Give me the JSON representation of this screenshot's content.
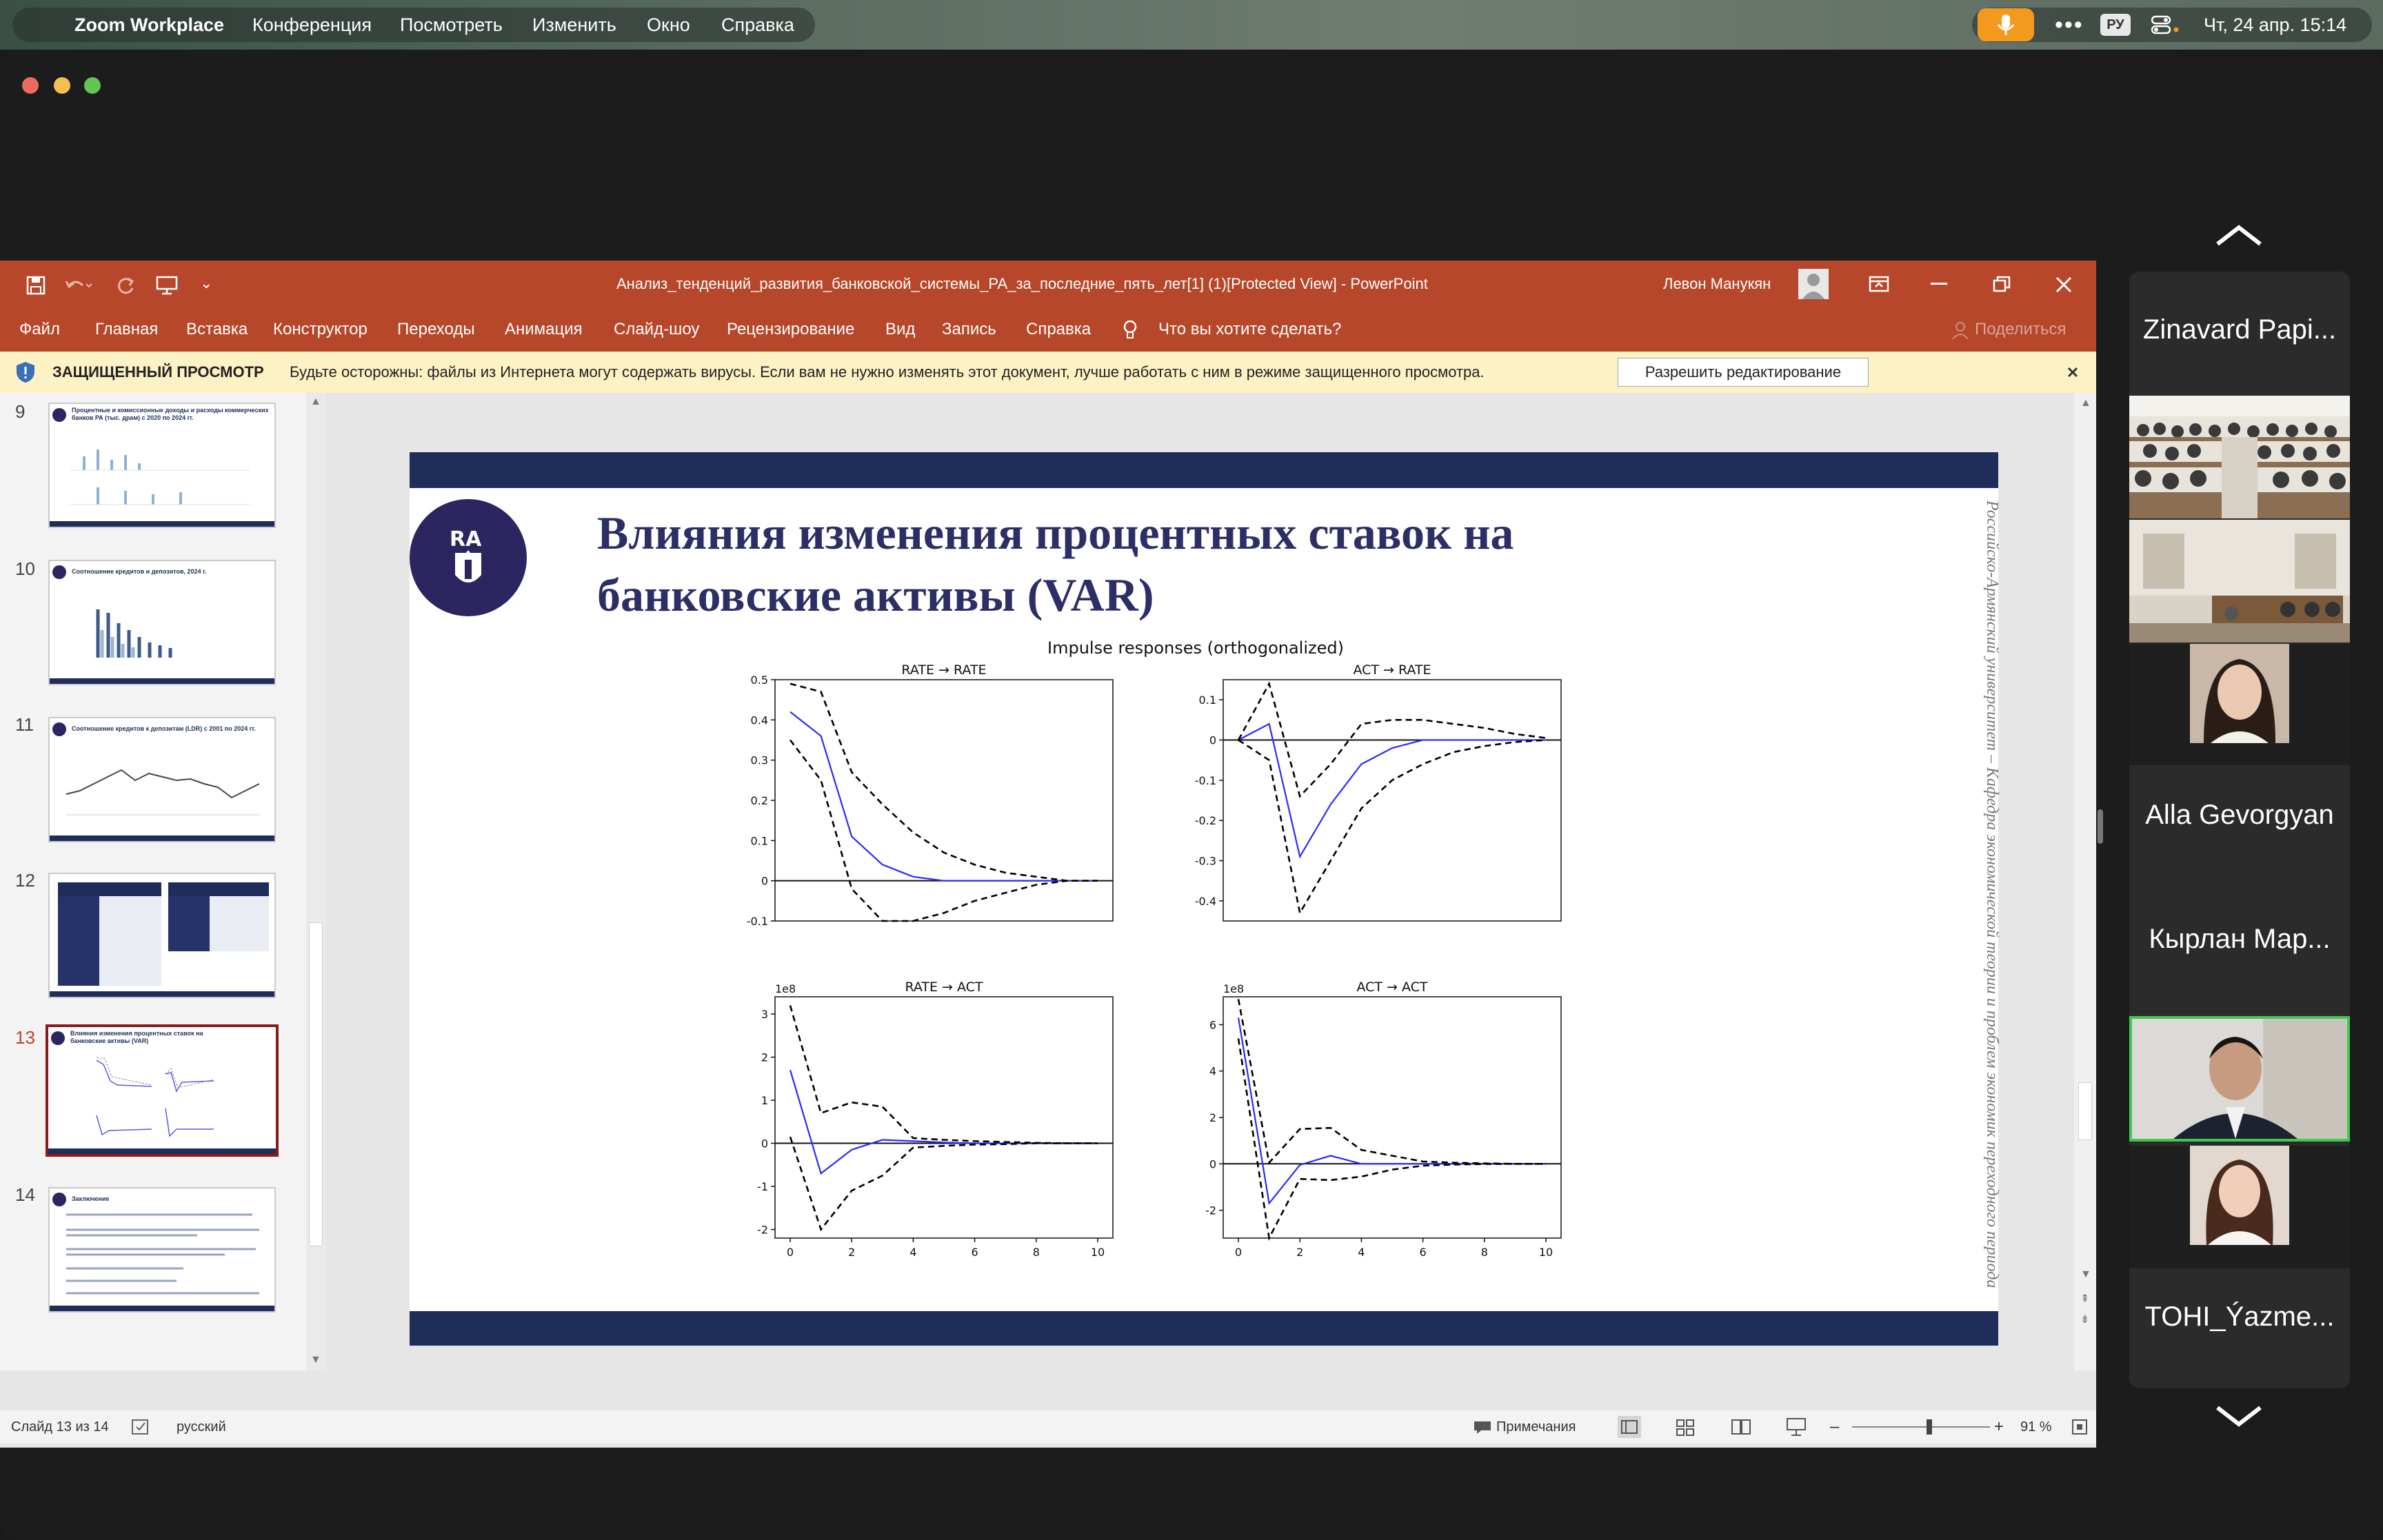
{
  "menubar": {
    "app_name": "Zoom Workplace",
    "items": [
      "Конференция",
      "Посмотреть",
      "Изменить",
      "Окно",
      "Справка"
    ],
    "keyboard_layout": "РУ",
    "clock": "Чт, 24 апр.  15:14"
  },
  "powerpoint": {
    "window_title": "Анализ_тенденций_развития_банковской_системы_РА_за_последние_пять_лет[1] (1)[Protected View]  -  PowerPoint",
    "user_name": "Левон Манукян",
    "tabs": [
      "Файл",
      "Главная",
      "Вставка",
      "Конструктор",
      "Переходы",
      "Анимация",
      "Слайд-шоу",
      "Рецензирование",
      "Вид",
      "Запись",
      "Справка"
    ],
    "tell_me": "Что вы хотите сделать?",
    "share": "Поделиться",
    "protected_title": "ЗАЩИЩЕННЫЙ ПРОСМОТР",
    "protected_message": "Будьте осторожны: файлы из Интернета могут содержать вирусы. Если вам не нужно изменять этот документ, лучше работать с ним в режиме защищенного просмотра.",
    "enable_editing": "Разрешить редактирование",
    "status_slide": "Слайд 13 из 14",
    "status_language": "русский",
    "notes": "Примечания",
    "zoom_level": "91 %",
    "zoom_fraction": 0.56
  },
  "thumbnails": [
    {
      "num": "9",
      "title": "Процентные и комиссионные доходы и расходы коммерческих банков РА (тыс. драм) с 2020 по 2024 гг.",
      "selected": false
    },
    {
      "num": "10",
      "title": "Соотношение кредитов и депозитов, 2024 г.",
      "selected": false
    },
    {
      "num": "11",
      "title": "Соотношение кредитов к депозитам (LDR) с 2001 по 2024 гг.",
      "selected": false
    },
    {
      "num": "12",
      "title": "",
      "selected": false
    },
    {
      "num": "13",
      "title": "Влияния изменения процентных ставок на банковские активы (VAR)",
      "selected": true
    },
    {
      "num": "14",
      "title": "Заключение",
      "selected": false
    }
  ],
  "slide": {
    "logo_text": "RA",
    "title_line1": "Влияния изменения процентных ставок на",
    "title_line2": "банковские активы (VAR)",
    "vertical_text": "Российско-Армянский университет – Кафедра экономической теории и проблем экономик переходного периода"
  },
  "chart_data": [
    {
      "type": "line",
      "suptitle": "Impulse responses (orthogonalized)",
      "title": "RATE → RATE",
      "x": [
        0,
        1,
        2,
        3,
        4,
        5,
        6,
        7,
        8,
        9,
        10
      ],
      "xlim": [
        0,
        10
      ],
      "ylim": [
        -0.1,
        0.5
      ],
      "yticks": [
        -0.1,
        0.0,
        0.1,
        0.2,
        0.3,
        0.4,
        0.5
      ],
      "xticks": [],
      "scale_label": "",
      "series": [
        {
          "values": [
            0.42,
            0.36,
            0.11,
            0.04,
            0.01,
            0.0,
            0.0,
            0.0,
            0.0,
            0.0,
            0.0
          ],
          "color": "#2a2aff",
          "style": "solid"
        },
        {
          "values": [
            0.49,
            0.47,
            0.27,
            0.19,
            0.12,
            0.07,
            0.04,
            0.02,
            0.01,
            0.0,
            0.0
          ],
          "color": "#000000",
          "style": "dashed"
        },
        {
          "values": [
            0.35,
            0.25,
            -0.02,
            -0.1,
            -0.1,
            -0.08,
            -0.05,
            -0.03,
            -0.01,
            0.0,
            0.0
          ],
          "color": "#000000",
          "style": "dashed"
        }
      ]
    },
    {
      "type": "line",
      "title": "ACT → RATE",
      "x": [
        0,
        1,
        2,
        3,
        4,
        5,
        6,
        7,
        8,
        9,
        10
      ],
      "xlim": [
        0,
        10
      ],
      "ylim": [
        -0.45,
        0.15
      ],
      "yticks": [
        -0.4,
        -0.3,
        -0.2,
        -0.1,
        0.0,
        0.1
      ],
      "xticks": [],
      "scale_label": "",
      "series": [
        {
          "values": [
            0.0,
            0.04,
            -0.29,
            -0.16,
            -0.06,
            -0.02,
            0.0,
            0.0,
            0.0,
            0.0,
            0.0
          ],
          "color": "#2a2aff",
          "style": "solid"
        },
        {
          "values": [
            0.0,
            0.14,
            -0.14,
            -0.06,
            0.04,
            0.05,
            0.05,
            0.04,
            0.03,
            0.015,
            0.005
          ],
          "color": "#000000",
          "style": "dashed"
        },
        {
          "values": [
            0.0,
            -0.05,
            -0.43,
            -0.3,
            -0.17,
            -0.1,
            -0.06,
            -0.03,
            -0.015,
            -0.005,
            0.0
          ],
          "color": "#000000",
          "style": "dashed"
        }
      ]
    },
    {
      "type": "line",
      "title": "RATE → ACT",
      "x": [
        0,
        1,
        2,
        3,
        4,
        5,
        6,
        7,
        8,
        9,
        10
      ],
      "xlim": [
        0,
        10
      ],
      "ylim": [
        -2.2,
        3.4
      ],
      "yticks": [
        -2,
        -1,
        0,
        1,
        2,
        3
      ],
      "xticks": [
        0,
        2,
        4,
        6,
        8,
        10
      ],
      "scale_label": "1e8",
      "series": [
        {
          "values": [
            1.7,
            -0.7,
            -0.15,
            0.08,
            0.05,
            0.02,
            0.0,
            0.0,
            0.0,
            0.0,
            0.0
          ],
          "color": "#2a2aff",
          "style": "solid"
        },
        {
          "values": [
            3.2,
            0.7,
            0.95,
            0.85,
            0.12,
            0.08,
            0.05,
            0.03,
            0.01,
            0.0,
            0.0
          ],
          "color": "#000000",
          "style": "dashed"
        },
        {
          "values": [
            0.15,
            -2.0,
            -1.1,
            -0.75,
            -0.1,
            -0.06,
            -0.03,
            -0.02,
            0.0,
            0.0,
            0.0
          ],
          "color": "#000000",
          "style": "dashed"
        }
      ]
    },
    {
      "type": "line",
      "title": "ACT → ACT",
      "x": [
        0,
        1,
        2,
        3,
        4,
        5,
        6,
        7,
        8,
        9,
        10
      ],
      "xlim": [
        0,
        10
      ],
      "ylim": [
        -3.2,
        7.2
      ],
      "yticks": [
        -2,
        0,
        2,
        4,
        6
      ],
      "xticks": [
        0,
        2,
        4,
        6,
        8,
        10
      ],
      "scale_label": "1e8",
      "series": [
        {
          "values": [
            6.3,
            -1.7,
            -0.05,
            0.35,
            0.0,
            0.0,
            0.0,
            0.0,
            0.0,
            0.0,
            0.0
          ],
          "color": "#2a2aff",
          "style": "solid"
        },
        {
          "values": [
            7.1,
            0.05,
            1.5,
            1.55,
            0.6,
            0.35,
            0.1,
            0.05,
            0.02,
            0.0,
            0.0
          ],
          "color": "#000000",
          "style": "dashed"
        },
        {
          "values": [
            5.4,
            -3.2,
            -0.65,
            -0.7,
            -0.55,
            -0.25,
            -0.08,
            -0.03,
            -0.01,
            0.0,
            0.0
          ],
          "color": "#000000",
          "style": "dashed"
        }
      ]
    }
  ],
  "gallery": {
    "participants": [
      {
        "name": "Zinavard Papi..."
      },
      {
        "name": "Alla Gevorgyan"
      },
      {
        "name": "Кырлан Мар..."
      },
      {
        "name": "TOHI_Ýazme..."
      }
    ]
  },
  "colors": {
    "powerpoint_accent": "#b7472a",
    "slide_navy": "#1f2d5a",
    "protected_bar": "#fdf2c4",
    "active_speaker": "#3fcb4f",
    "mic_orange": "#f39a1e"
  }
}
